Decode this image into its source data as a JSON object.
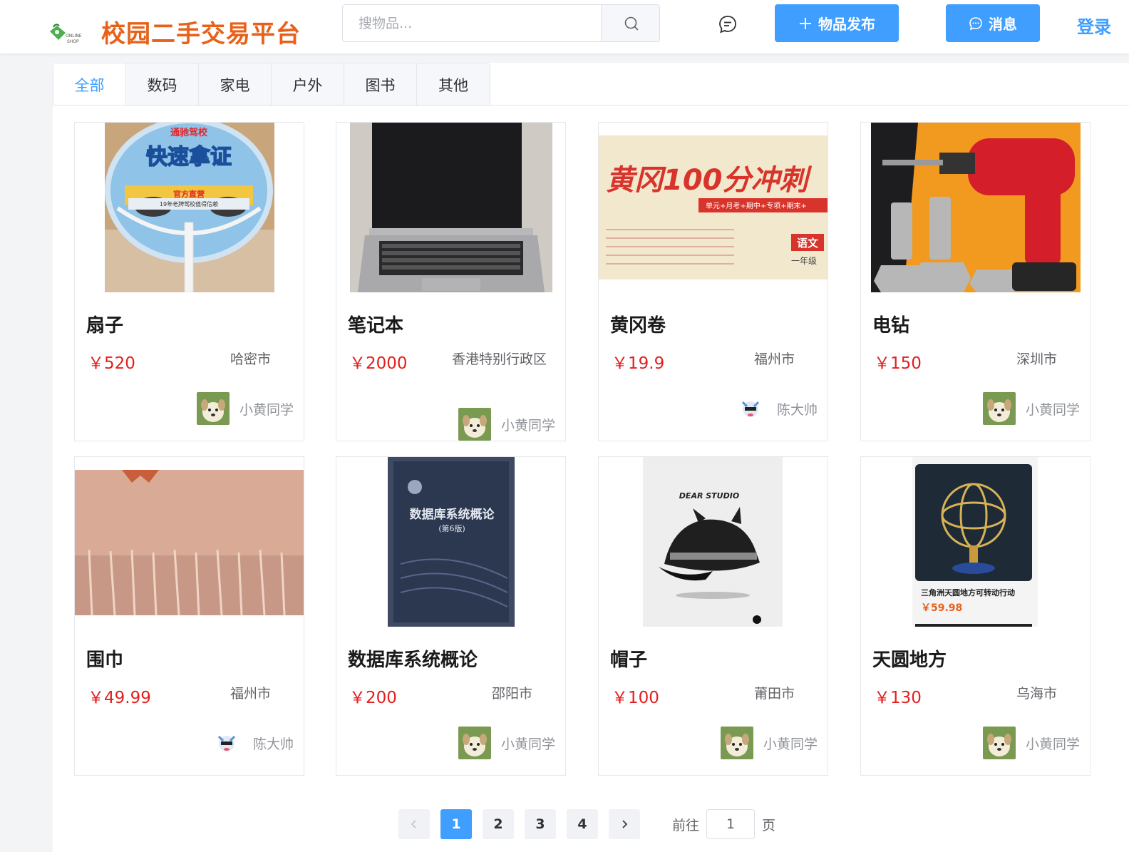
{
  "header": {
    "brand": "校园二手交易平台",
    "search_placeholder": "搜物品...",
    "publish_label": "物品发布",
    "message_label": "消息",
    "login_label": "登录"
  },
  "tabs": [
    {
      "label": "全部",
      "active": true
    },
    {
      "label": "数码"
    },
    {
      "label": "家电"
    },
    {
      "label": "户外"
    },
    {
      "label": "图书"
    },
    {
      "label": "其他"
    }
  ],
  "items": [
    {
      "name": "扇子",
      "price": "￥520",
      "city": "哈密市",
      "seller": "小黄同学",
      "image": "fan"
    },
    {
      "name": "笔记本",
      "price": "￥2000",
      "city": "香港特别行政区",
      "seller": "小黄同学",
      "image": "laptop"
    },
    {
      "name": "黄冈卷",
      "price": "￥19.9",
      "city": "福州市",
      "seller": "陈大帅",
      "image": "exam-paper"
    },
    {
      "name": "电钻",
      "price": "￥150",
      "city": "深圳市",
      "seller": "小黄同学",
      "image": "drill"
    },
    {
      "name": "围巾",
      "price": "￥49.99",
      "city": "福州市",
      "seller": "陈大帅",
      "image": "scarf"
    },
    {
      "name": "数据库系统概论",
      "price": "￥200",
      "city": "邵阳市",
      "seller": "小黄同学",
      "image": "db-book"
    },
    {
      "name": "帽子",
      "price": "￥100",
      "city": "莆田市",
      "seller": "小黄同学",
      "image": "hat"
    },
    {
      "name": "天圆地方",
      "price": "￥130",
      "city": "乌海市",
      "seller": "小黄同学",
      "image": "armillary"
    }
  ],
  "image_text": {
    "fan_school": "通驰驾校",
    "fan_main": "快速拿证",
    "fan_sub": "官方直营",
    "fan_small": "19年老牌驾校值得信赖",
    "exam_title": "黄冈100分冲刺",
    "exam_sub": "单元+月考+期中+专项+期末+",
    "exam_tag": "语文",
    "exam_grade": "一年级",
    "book_title": "数据库系统概论",
    "book_edition": "(第6版)",
    "hat_brand": "DEAR STUDIO",
    "globe_caption": "三角洲天圆地方可转动行动",
    "globe_price": "￥59.98"
  },
  "pagination": {
    "pages": [
      "1",
      "2",
      "3",
      "4"
    ],
    "current": "1",
    "goto_label": "前往",
    "goto_value": "1",
    "page_suffix": "页"
  },
  "colors": {
    "brand": "#e8611a",
    "primary": "#409eff",
    "price": "#e41e1e"
  }
}
